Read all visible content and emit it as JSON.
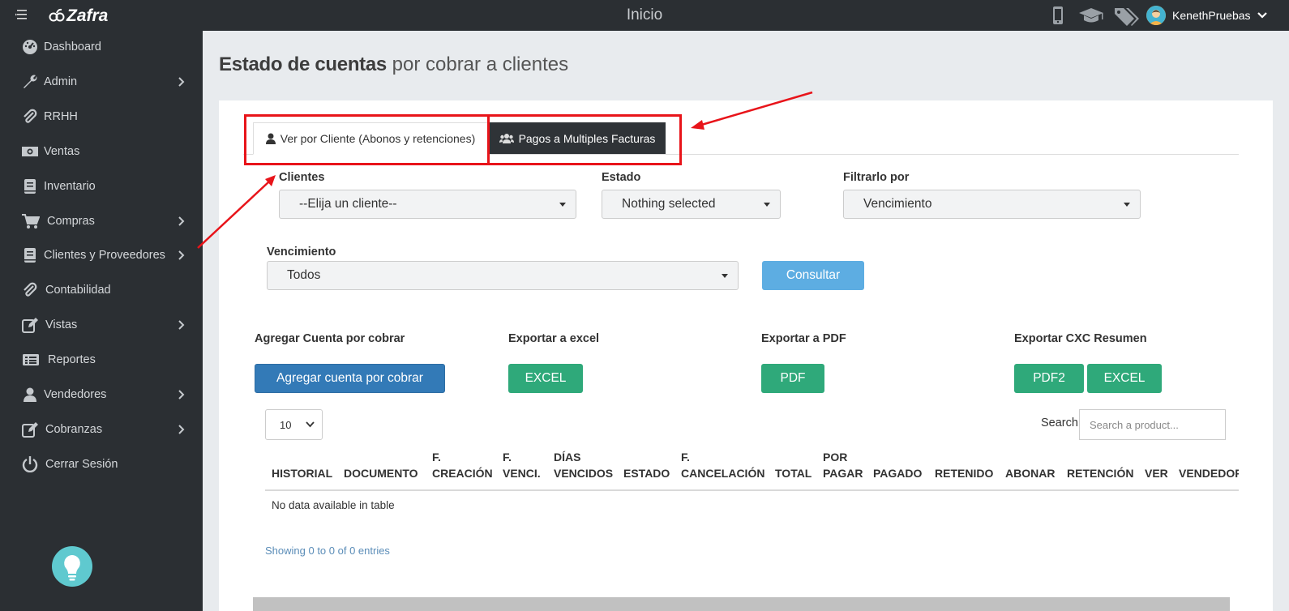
{
  "topbar": {
    "logo": "Zafra",
    "title": "Inicio",
    "user": "KenethPruebas"
  },
  "sidebar": {
    "items": [
      {
        "label": "Dashboard",
        "icon": "dashboard-icon"
      },
      {
        "label": "Admin",
        "icon": "wrench-icon"
      },
      {
        "label": "RRHH",
        "icon": "paperclip-icon"
      },
      {
        "label": "Ventas",
        "icon": "money-icon"
      },
      {
        "label": "Inventario",
        "icon": "book-icon"
      },
      {
        "label": "Compras",
        "icon": "cart-icon"
      },
      {
        "label": "Clientes y Proveedores",
        "icon": "book-icon"
      },
      {
        "label": "Contabilidad",
        "icon": "paperclip-icon"
      },
      {
        "label": "Vistas",
        "icon": "edit-icon"
      },
      {
        "label": "Reportes",
        "icon": "list-icon"
      },
      {
        "label": "Vendedores",
        "icon": "user-icon"
      },
      {
        "label": "Cobranzas",
        "icon": "edit-icon"
      },
      {
        "label": "Cerrar Sesión",
        "icon": "power-icon"
      }
    ]
  },
  "page": {
    "heading_bold": "Estado de cuentas",
    "heading_rest": "por cobrar a clientes"
  },
  "tabs": {
    "tab1": "Ver por Cliente (Abonos y retenciones)",
    "tab2": "Pagos a Multiples Facturas"
  },
  "filters": {
    "clientes_label": "Clientes",
    "clientes_value": "--Elija un cliente--",
    "estado_label": "Estado",
    "estado_value": "Nothing selected",
    "filtrar_label": "Filtrarlo por",
    "filtrar_value": "Vencimiento",
    "vencimiento_label": "Vencimiento",
    "vencimiento_value": "Todos",
    "consultar": "Consultar"
  },
  "actions": {
    "agregar_label": "Agregar Cuenta por cobrar",
    "agregar_button": "Agregar cuenta por cobrar",
    "excel_label": "Exportar a excel",
    "excel_button": "EXCEL",
    "pdf_label": "Exportar a PDF",
    "pdf_button": "PDF",
    "cxc_label": "Exportar CXC Resumen",
    "cxc_pdf2": "PDF2",
    "cxc_excel": "EXCEL"
  },
  "table": {
    "page_size": "10",
    "search_label": "Search:",
    "search_placeholder": "Search a product...",
    "columns": [
      "HISTORIAL",
      "DOCUMENTO",
      "F. CREACIÓN",
      "F. VENCI.",
      "DÍAS VENCIDOS",
      "ESTADO",
      "F. CANCELACIÓN",
      "TOTAL",
      "POR PAGAR",
      "PAGADO",
      "RETENIDO",
      "ABONAR",
      "RETENCIÓN",
      "VER",
      "VENDEDOR"
    ],
    "empty_message": "No data available in table",
    "info": "Showing 0 to 0 of 0 entries"
  },
  "colors": {
    "sidebar": "#2b2f33",
    "highlight": "#e8141a",
    "primary": "#337ab7",
    "success": "#2fa97a"
  }
}
